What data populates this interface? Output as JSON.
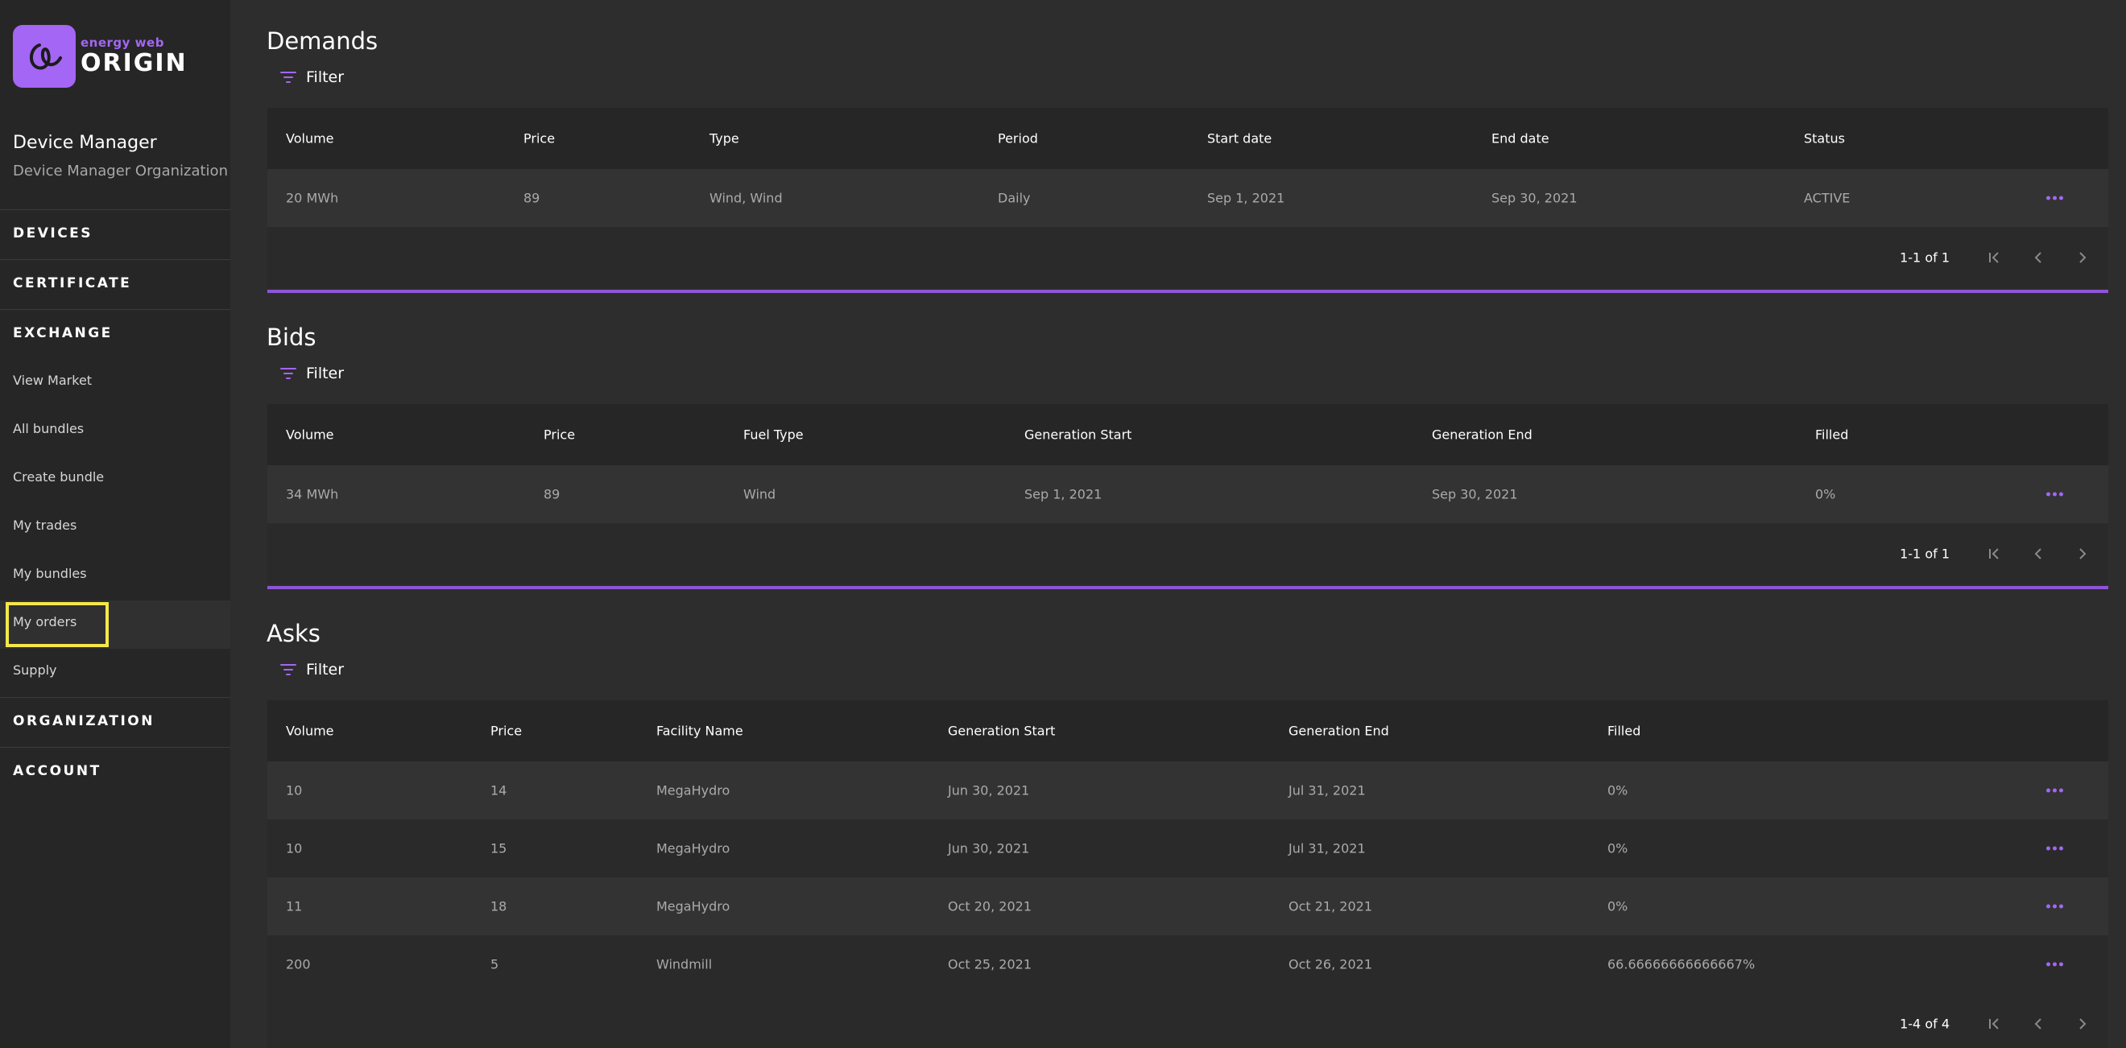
{
  "colors": {
    "accent": "#a466f4",
    "sidebar_bg": "#262626",
    "main_bg": "#2d2d2d",
    "highlight": "#f5e74a"
  },
  "logo": {
    "small": "energy web",
    "big": "ORIGIN"
  },
  "user": {
    "name": "Device Manager",
    "organization": "Device Manager Organization"
  },
  "nav": {
    "devices": "DEVICES",
    "certificate": "CERTIFICATE",
    "exchange": "EXCHANGE",
    "exchange_items": [
      "View Market",
      "All bundles",
      "Create bundle",
      "My trades",
      "My bundles",
      "My orders",
      "Supply"
    ],
    "active_item": "My orders",
    "organization": "ORGANIZATION",
    "account": "ACCOUNT"
  },
  "filter_label": "Filter",
  "demands": {
    "title": "Demands",
    "columns": [
      "Volume",
      "Price",
      "Type",
      "Period",
      "Start date",
      "End date",
      "Status"
    ],
    "rows": [
      [
        "20 MWh",
        "89",
        "Wind, Wind",
        "Daily",
        "Sep 1, 2021",
        "Sep 30, 2021",
        "ACTIVE"
      ]
    ],
    "pagination": "1-1 of 1"
  },
  "bids": {
    "title": "Bids",
    "columns": [
      "Volume",
      "Price",
      "Fuel Type",
      "Generation Start",
      "Generation End",
      "Filled"
    ],
    "rows": [
      [
        "34 MWh",
        "89",
        "Wind",
        "Sep 1, 2021",
        "Sep 30, 2021",
        "0%"
      ]
    ],
    "pagination": "1-1 of 1"
  },
  "asks": {
    "title": "Asks",
    "columns": [
      "Volume",
      "Price",
      "Facility Name",
      "Generation Start",
      "Generation End",
      "Filled"
    ],
    "rows": [
      [
        "10",
        "14",
        "MegaHydro",
        "Jun 30, 2021",
        "Jul 31, 2021",
        "0%"
      ],
      [
        "10",
        "15",
        "MegaHydro",
        "Jun 30, 2021",
        "Jul 31, 2021",
        "0%"
      ],
      [
        "11",
        "18",
        "MegaHydro",
        "Oct 20, 2021",
        "Oct 21, 2021",
        "0%"
      ],
      [
        "200",
        "5",
        "Windmill",
        "Oct 25, 2021",
        "Oct 26, 2021",
        "66.66666666666667%"
      ]
    ],
    "pagination": "1-4 of 4"
  }
}
